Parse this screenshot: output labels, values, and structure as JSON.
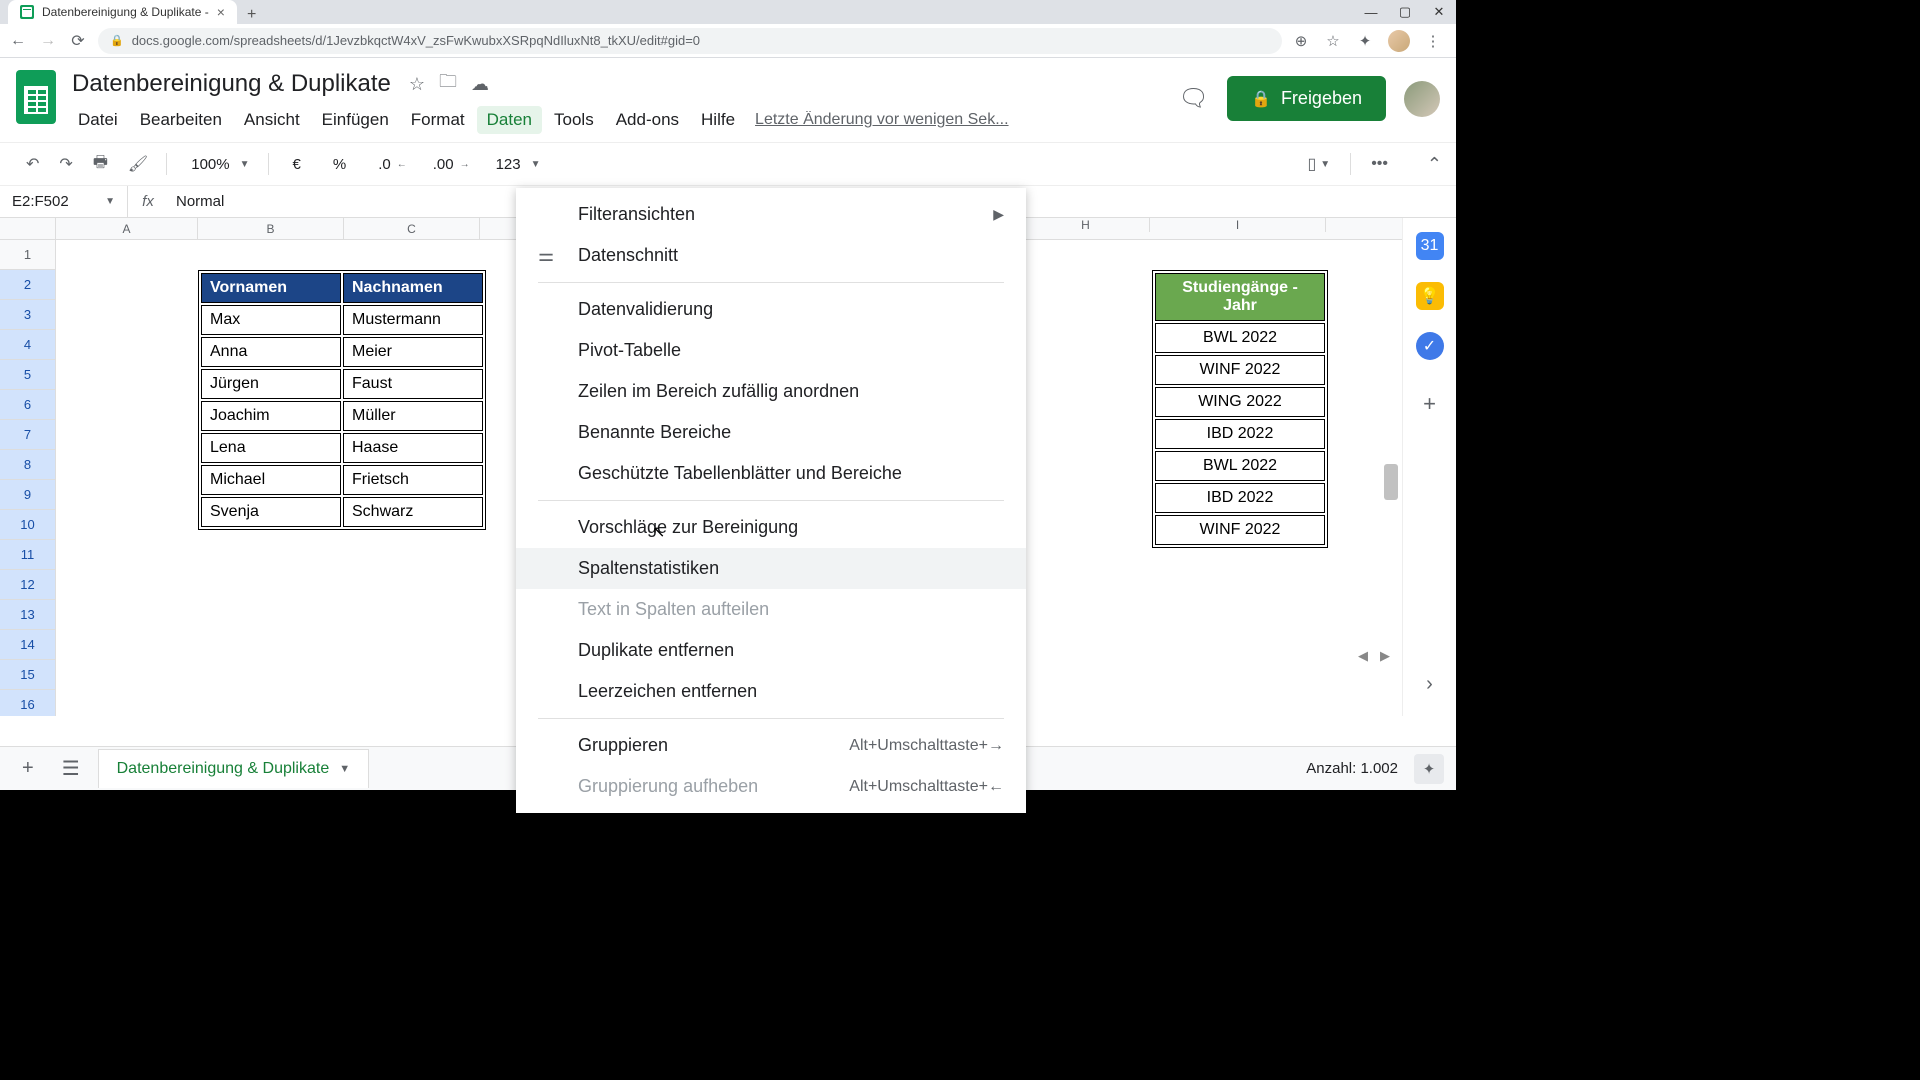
{
  "browser": {
    "tab_title": "Datenbereinigung & Duplikate - ",
    "url": "docs.google.com/spreadsheets/d/1JevzbkqctW4xV_zsFwKwubxXSRpqNdIluxNt8_tkXU/edit#gid=0"
  },
  "doc": {
    "title": "Datenbereinigung & Duplikate",
    "last_edit": "Letzte Änderung vor wenigen Sek...",
    "share_label": "Freigeben"
  },
  "menu": {
    "datei": "Datei",
    "bearbeiten": "Bearbeiten",
    "ansicht": "Ansicht",
    "einfuegen": "Einfügen",
    "format": "Format",
    "daten": "Daten",
    "tools": "Tools",
    "addons": "Add-ons",
    "hilfe": "Hilfe"
  },
  "toolbar": {
    "zoom": "100%",
    "currency": "€",
    "percent": "%",
    "dec_dec": ".0",
    "dec_inc": ".00",
    "nums": "123",
    "more": "•••"
  },
  "formula": {
    "name_box": "E2:F502",
    "fx": "fx",
    "value": "Normal"
  },
  "columns": [
    "A",
    "B",
    "C",
    "H",
    "I"
  ],
  "rows": [
    1,
    2,
    3,
    4,
    5,
    6,
    7,
    8,
    9,
    10,
    11,
    12,
    13,
    14,
    15,
    16
  ],
  "table1": {
    "headers": [
      "Vornamen",
      "Nachnamen"
    ],
    "rows": [
      [
        "Max",
        "Mustermann"
      ],
      [
        "Anna",
        "Meier"
      ],
      [
        "Jürgen",
        "Faust"
      ],
      [
        "Joachim",
        "Müller"
      ],
      [
        "Lena",
        "Haase"
      ],
      [
        "Michael",
        "Frietsch"
      ],
      [
        "Svenja",
        "Schwarz"
      ]
    ]
  },
  "table2": {
    "header": "Studiengänge - Jahr",
    "rows": [
      "BWL 2022",
      "WINF 2022",
      "WING 2022",
      "IBD 2022",
      "BWL 2022",
      "IBD 2022",
      "WINF 2022"
    ]
  },
  "dropdown": {
    "filteransichten": "Filteransichten",
    "datenschnitt": "Datenschnitt",
    "datenvalidierung": "Datenvalidierung",
    "pivot": "Pivot-Tabelle",
    "zufallig": "Zeilen im Bereich zufällig anordnen",
    "benannte": "Benannte Bereiche",
    "geschuetzte": "Geschützte Tabellenblätter und Bereiche",
    "vorschlaege": "Vorschläge zur Bereinigung",
    "spaltenstat": "Spaltenstatistiken",
    "text_spalten": "Text in Spalten aufteilen",
    "duplikate": "Duplikate entfernen",
    "leerzeichen": "Leerzeichen entfernen",
    "gruppieren": "Gruppieren",
    "gruppieren_key": "Alt+Umschalttaste+→",
    "gruppierung_aufheben": "Gruppierung aufheben",
    "gruppierung_aufheben_key": "Alt+Umschalttaste+←"
  },
  "bottom": {
    "sheet_name": "Datenbereinigung & Duplikate",
    "count_label": "Anzahl: 1.002"
  }
}
